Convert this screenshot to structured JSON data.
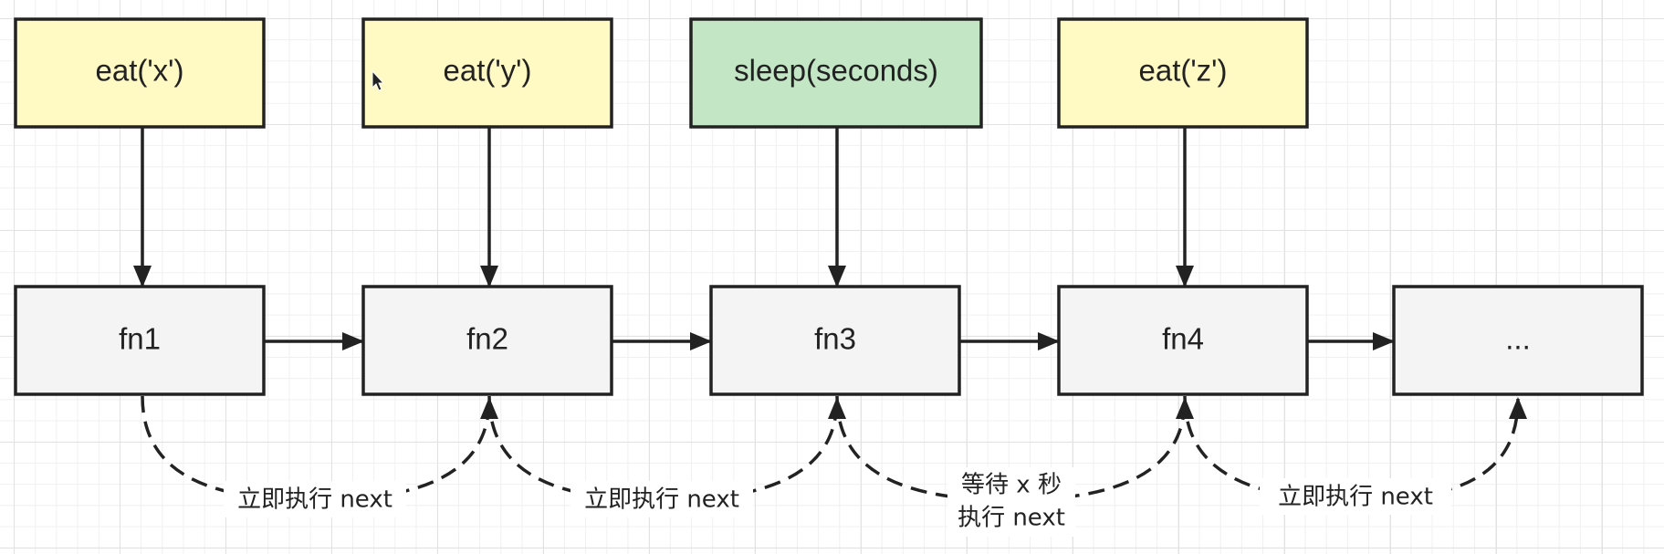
{
  "colors": {
    "call_fill": "#fff9c4",
    "sleep_fill": "#c3e6c5",
    "fn_fill": "#f4f4f4",
    "stroke": "#222222"
  },
  "nodes": {
    "call_eat_x": "eat('x')",
    "call_eat_y": "eat('y')",
    "call_sleep": "sleep(seconds)",
    "call_eat_z": "eat('z')",
    "fn1": "fn1",
    "fn2": "fn2",
    "fn3": "fn3",
    "fn4": "fn4",
    "fn_more": "..."
  },
  "edge_labels": {
    "fn1_to_fn2": "立即执行 next",
    "fn2_to_fn3": "立即执行 next",
    "fn3_to_fn4_line1": "等待 x 秒",
    "fn3_to_fn4_line2": "执行 next",
    "fn4_to_more": "立即执行 next"
  }
}
